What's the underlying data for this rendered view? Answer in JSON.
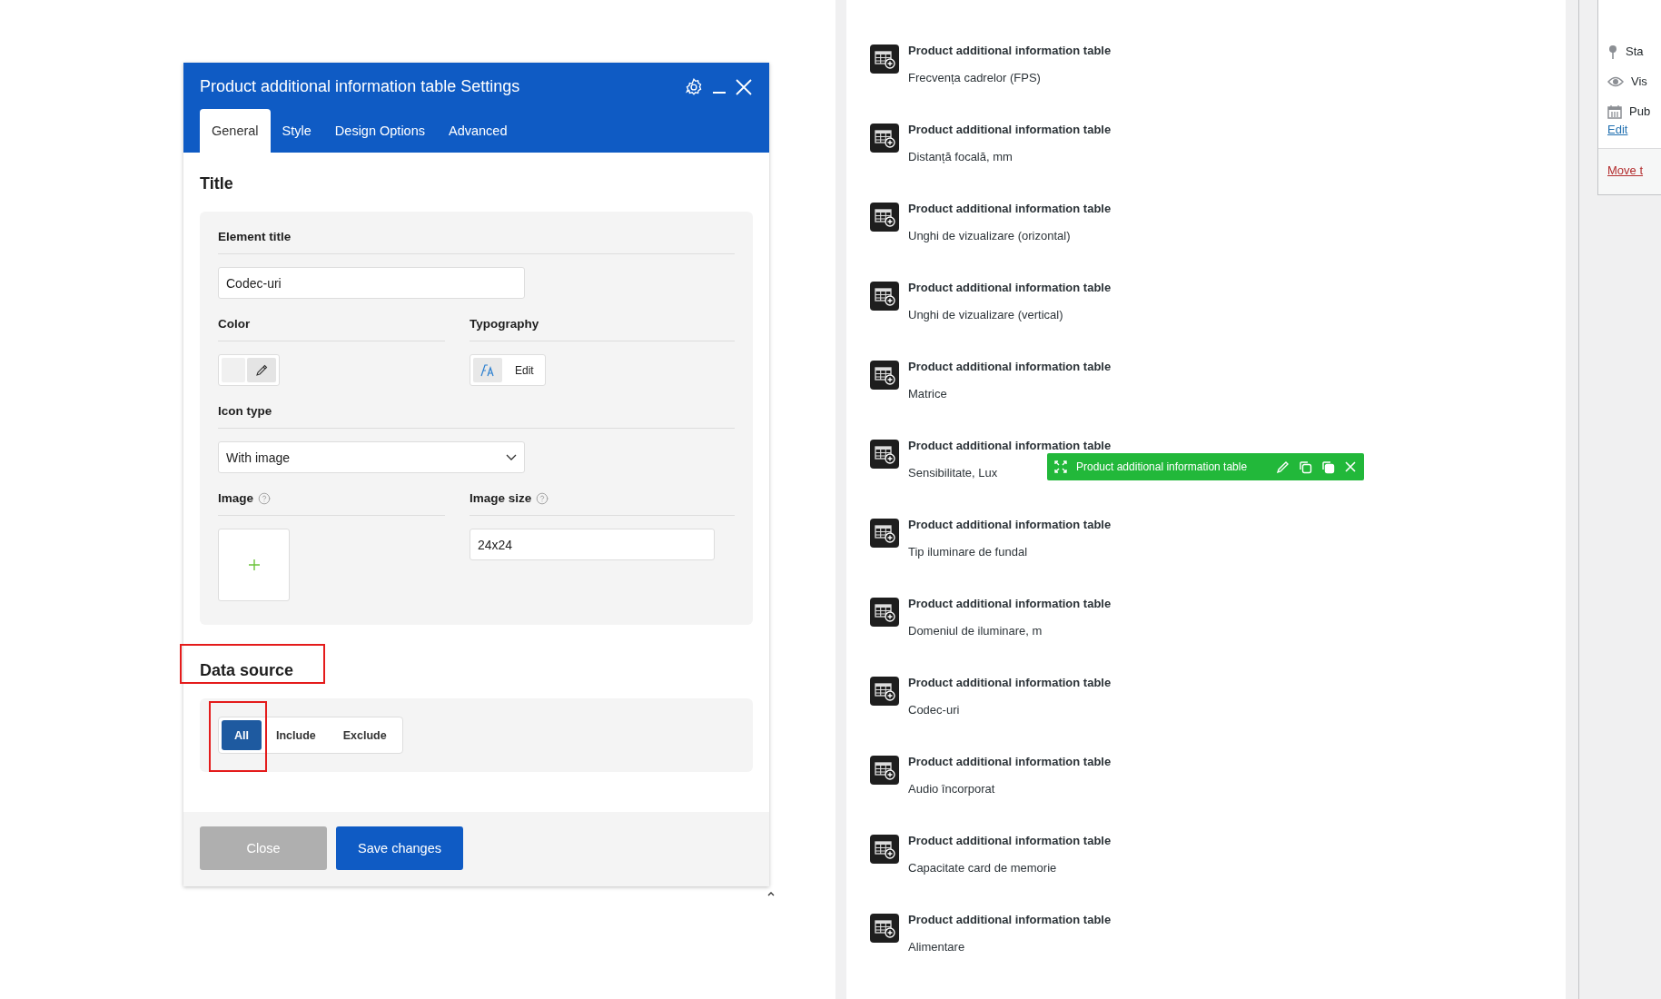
{
  "dialog": {
    "title": "Product additional information table Settings",
    "tabs": [
      {
        "label": "General",
        "selected": true
      },
      {
        "label": "Style",
        "selected": false
      },
      {
        "label": "Design Options",
        "selected": false
      },
      {
        "label": "Advanced",
        "selected": false
      }
    ],
    "title_section": {
      "heading": "Title",
      "element_title": {
        "label": "Element title",
        "value": "Codec-uri"
      },
      "color": {
        "label": "Color"
      },
      "typography": {
        "label": "Typography",
        "button": "Edit"
      },
      "icon_type": {
        "label": "Icon type",
        "value": "With image"
      },
      "image": {
        "label": "Image"
      },
      "image_size": {
        "label": "Image size",
        "value": "24x24"
      }
    },
    "data_source": {
      "heading": "Data source",
      "highlighted": true,
      "options": [
        {
          "label": "All",
          "selected": true,
          "highlighted": true
        },
        {
          "label": "Include",
          "selected": false,
          "highlighted": false
        },
        {
          "label": "Exclude",
          "selected": false,
          "highlighted": false
        }
      ]
    },
    "buttons": [
      {
        "label": "Close",
        "kind": "secondary"
      },
      {
        "label": "Save changes",
        "kind": "primary"
      }
    ]
  },
  "elements": {
    "toolbar": {
      "label": "Product additional information table"
    },
    "items": [
      {
        "title": "Product additional information table",
        "subtitle": "Frecvența cadrelor (FPS)",
        "hovered": false
      },
      {
        "title": "Product additional information table",
        "subtitle": "Distanță focală, mm",
        "hovered": false
      },
      {
        "title": "Product additional information table",
        "subtitle": "Unghi de vizualizare (orizontal)",
        "hovered": false
      },
      {
        "title": "Product additional information table",
        "subtitle": "Unghi de vizualizare (vertical)",
        "hovered": false
      },
      {
        "title": "Product additional information table",
        "subtitle": "Matrice",
        "hovered": false
      },
      {
        "title": "Product additional information table",
        "subtitle": "Sensibilitate, Lux",
        "hovered": true
      },
      {
        "title": "Product additional information table",
        "subtitle": "Tip iluminare de fundal",
        "hovered": false
      },
      {
        "title": "Product additional information table",
        "subtitle": "Domeniul de iluminare, m",
        "hovered": false
      },
      {
        "title": "Product additional information table",
        "subtitle": "Codec-uri",
        "hovered": false
      },
      {
        "title": "Product additional information table",
        "subtitle": "Audio încorporat",
        "hovered": false
      },
      {
        "title": "Product additional information table",
        "subtitle": "Capacitate card de memorie",
        "hovered": false
      },
      {
        "title": "Product additional information table",
        "subtitle": "Alimentare",
        "hovered": false
      }
    ]
  },
  "sidebar": {
    "items": [
      {
        "kind": "status",
        "label": "Sta"
      },
      {
        "kind": "visibility",
        "label": "Vis"
      },
      {
        "kind": "publish",
        "label": "Pub"
      }
    ],
    "edit_link": "Edit",
    "trash_link": "Move t"
  }
}
